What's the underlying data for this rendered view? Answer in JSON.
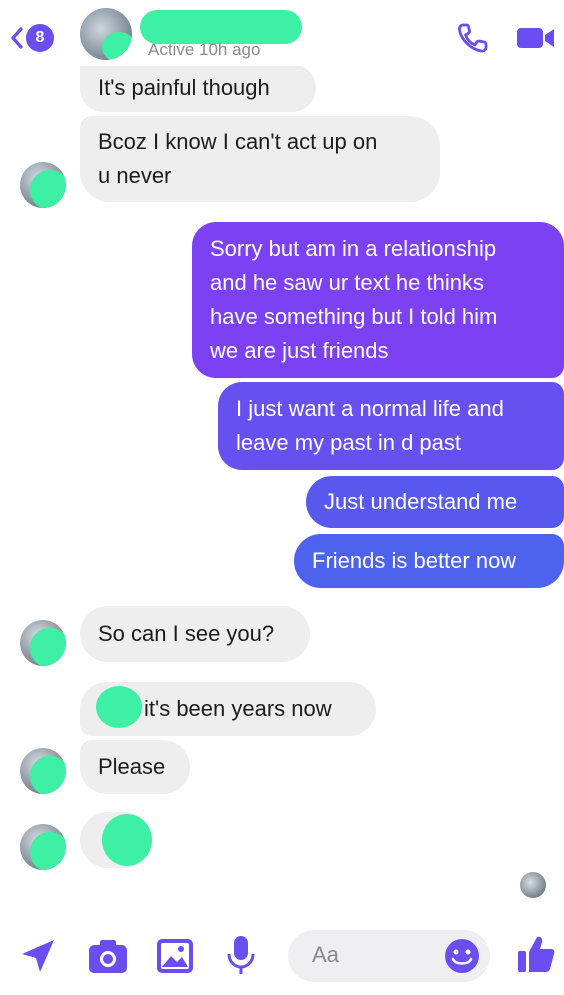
{
  "header": {
    "back_badge": "8",
    "status": "Active 10h ago"
  },
  "messages": [
    {
      "side": "in",
      "text": "It's painful though"
    },
    {
      "side": "in",
      "line1": "Bcoz I know I can't act up on",
      "line2": "u never"
    },
    {
      "side": "out",
      "line1": "Sorry but am in a relationship",
      "line2": "and he saw ur text he thinks",
      "line3": "have something but I told him",
      "line4": "we are just friends"
    },
    {
      "side": "out",
      "line1": "I just want a normal life and",
      "line2": "leave my past in d past"
    },
    {
      "side": "out",
      "text": "Just understand me"
    },
    {
      "side": "out",
      "text": "Friends is better now"
    },
    {
      "side": "in",
      "text": "So can I see you?"
    },
    {
      "side": "in",
      "text": "it's been years now"
    },
    {
      "side": "in",
      "text": "Please"
    }
  ],
  "composer": {
    "placeholder": "Aa"
  },
  "colors": {
    "accent": "#6b4ef2",
    "outgoing_top": "#7b41f3",
    "outgoing_bottom": "#4d63ee",
    "incoming": "#eeeeef",
    "redaction": "#3ef0a4"
  },
  "icons": [
    "back-chevron-icon",
    "phone-icon",
    "video-camera-icon",
    "location-arrow-icon",
    "camera-icon",
    "image-icon",
    "microphone-icon",
    "emoji-icon",
    "thumbs-up-icon"
  ]
}
